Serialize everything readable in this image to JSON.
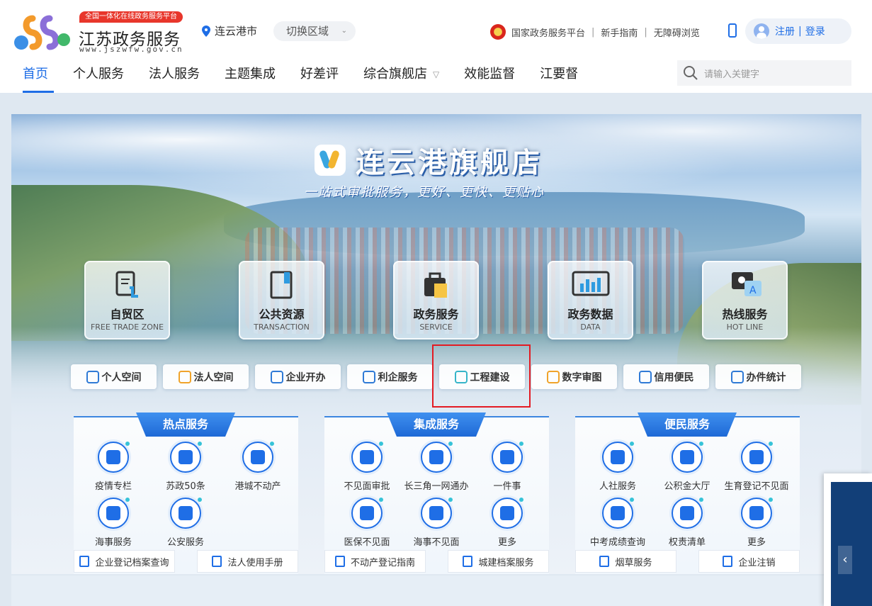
{
  "header": {
    "badge": "全国一体化在线政务服务平台",
    "site_name": "江苏政务服务",
    "site_url": "www.jszwfw.gov.cn",
    "city": "连云港市",
    "switch_label": "切换区域",
    "links": [
      "国家政务服务平台",
      "新手指南",
      "无障碍浏览"
    ],
    "register": "注册",
    "login": "登录",
    "login_sep": "|"
  },
  "nav": {
    "items": [
      "首页",
      "个人服务",
      "法人服务",
      "主题集成",
      "好差评",
      "综合旗舰店",
      "效能监督",
      "江要督"
    ],
    "active": "首页",
    "search_placeholder": "请输入关键字"
  },
  "banner": {
    "title": "连云港旗舰店",
    "subtitle": "一站式审批服务，更好、更快、更贴心",
    "cards": [
      {
        "cn": "自贸区",
        "en": "FREE TRADE ZONE",
        "icon": "document-hand-icon"
      },
      {
        "cn": "公共资源",
        "en": "TRANSACTION",
        "icon": "book-icon"
      },
      {
        "cn": "政务服务",
        "en": "SERVICE",
        "icon": "briefcase-icon"
      },
      {
        "cn": "政务数据",
        "en": "DATA",
        "icon": "monitor-chart-icon"
      },
      {
        "cn": "热线服务",
        "en": "HOT LINE",
        "icon": "chat-icon"
      }
    ],
    "quick": [
      "个人空间",
      "法人空间",
      "企业开办",
      "利企服务",
      "工程建设",
      "数字审图",
      "信用便民",
      "办件统计"
    ]
  },
  "panels": [
    {
      "title": "热点服务",
      "items": [
        "疫情专栏",
        "苏政50条",
        "港城不动产",
        "海事服务",
        "公安服务"
      ],
      "links": [
        "企业登记档案查询",
        "法人使用手册"
      ]
    },
    {
      "title": "集成服务",
      "items": [
        "不见面审批",
        "长三角一网通办",
        "一件事",
        "医保不见面",
        "海事不见面",
        "更多"
      ],
      "links": [
        "不动产登记指南",
        "城建档案服务"
      ]
    },
    {
      "title": "便民服务",
      "items": [
        "人社服务",
        "公积金大厅",
        "生育登记不见面",
        "中考成绩查询",
        "权责清单",
        "更多"
      ],
      "links": [
        "烟草服务",
        "企业注销"
      ]
    }
  ],
  "colors": {
    "accent": "#1f6ee6",
    "highlight": "#e31b23"
  }
}
